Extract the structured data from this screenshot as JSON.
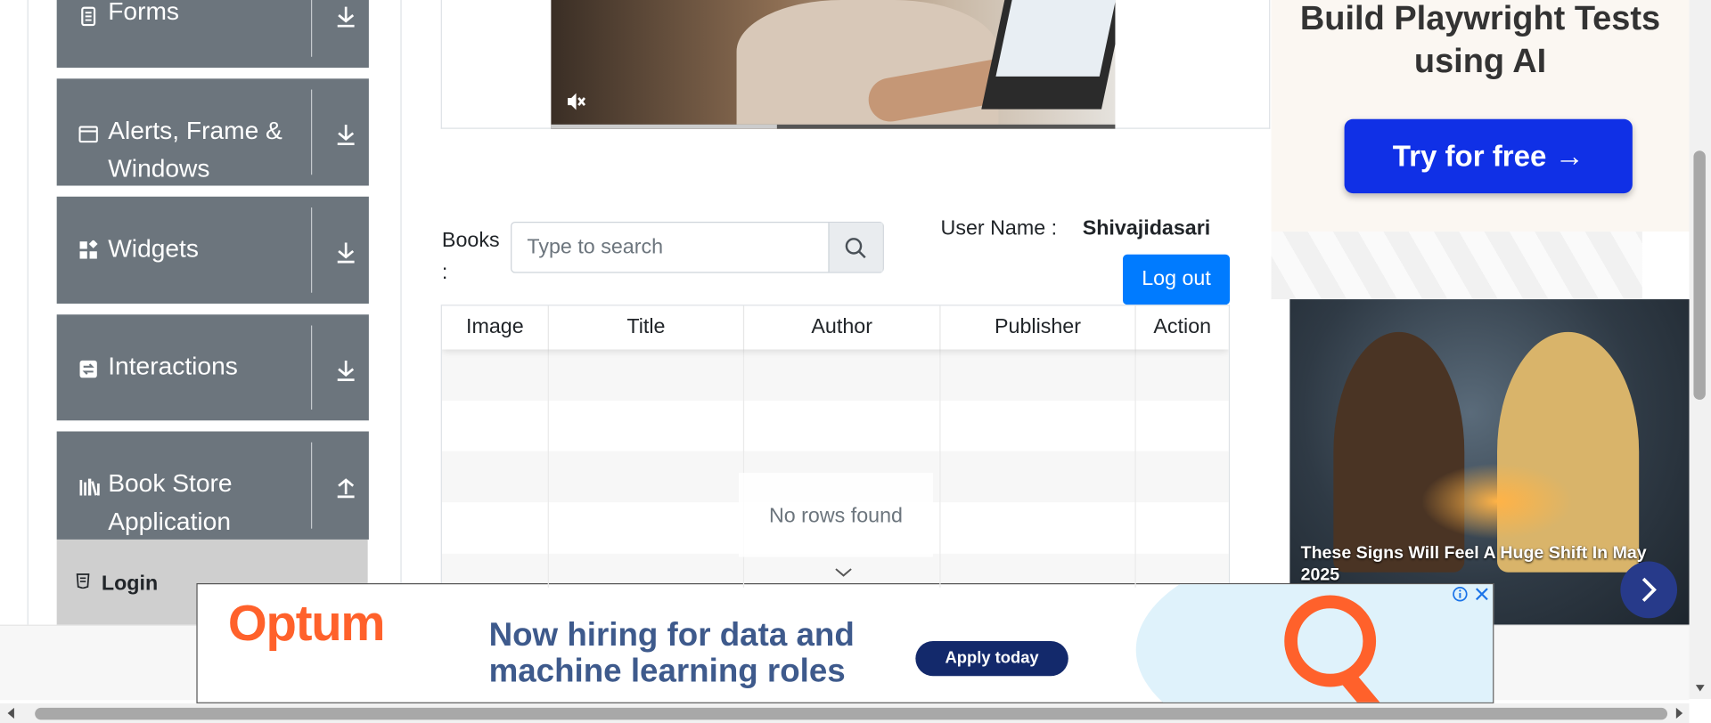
{
  "sidebar": {
    "groups": [
      {
        "title": "Forms"
      },
      {
        "title": "Alerts, Frame & Windows"
      },
      {
        "title": "Widgets"
      },
      {
        "title": "Interactions"
      },
      {
        "title": "Book Store Application"
      }
    ],
    "active_item": {
      "label": "Login"
    }
  },
  "books": {
    "label": "Books :",
    "search": {
      "placeholder": "Type to search",
      "value": ""
    },
    "user_label": "User Name :",
    "user_value": "Shivajidasari",
    "logout_label": "Log out",
    "table": {
      "columns": [
        "Image",
        "Title",
        "Author",
        "Publisher",
        "Action"
      ],
      "empty_text": "No rows found"
    }
  },
  "ads": {
    "top": {
      "headline": "Build Playwright Tests using AI",
      "cta": "Try for free →"
    },
    "image_ad": {
      "caption": "These Signs Will Feel A Huge Shift In May 2025"
    },
    "banner": {
      "brand": "Optum",
      "message": "Now hiring for data and machine learning roles",
      "cta": "Apply today"
    }
  },
  "colors": {
    "sidebar_bg": "#6c757d",
    "primary": "#007bff",
    "login_item_bg": "#cfcfcf",
    "ad_cta": "#1030e6",
    "banner_brand": "#ff612b"
  }
}
